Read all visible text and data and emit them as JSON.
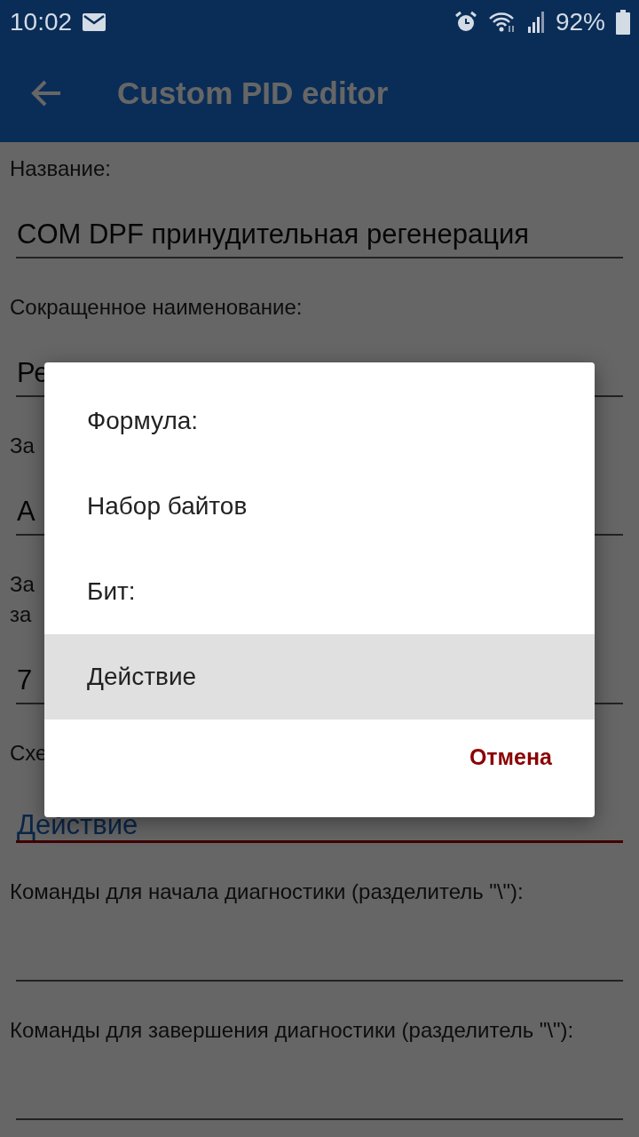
{
  "status_bar": {
    "time": "10:02",
    "battery": "92%"
  },
  "app_bar": {
    "title": "Custom PID editor"
  },
  "fields": [
    {
      "label": "Название:",
      "value": "COM DPF принудительная регенерация",
      "focused": false
    },
    {
      "label": "Сокращенное наименование:",
      "value": "Ре",
      "focused": false
    },
    {
      "label": "За",
      "value": "А",
      "focused": false
    },
    {
      "label": "За\nза",
      "value": "7",
      "focused": false
    },
    {
      "label": "Схе",
      "value": "Действие",
      "focused": true
    },
    {
      "label": "Команды для начала диагностики (разделитель \"\\\"):",
      "focused": false
    },
    {
      "label": "Команды для завершения диагностики (разделитель \"\\\"):",
      "focused": false
    }
  ],
  "dialog": {
    "options": [
      {
        "label": "Формула:",
        "selected": false
      },
      {
        "label": "Набор байтов",
        "selected": false
      },
      {
        "label": "Бит:",
        "selected": false
      },
      {
        "label": "Действие",
        "selected": true
      }
    ],
    "cancel": "Отмена"
  }
}
